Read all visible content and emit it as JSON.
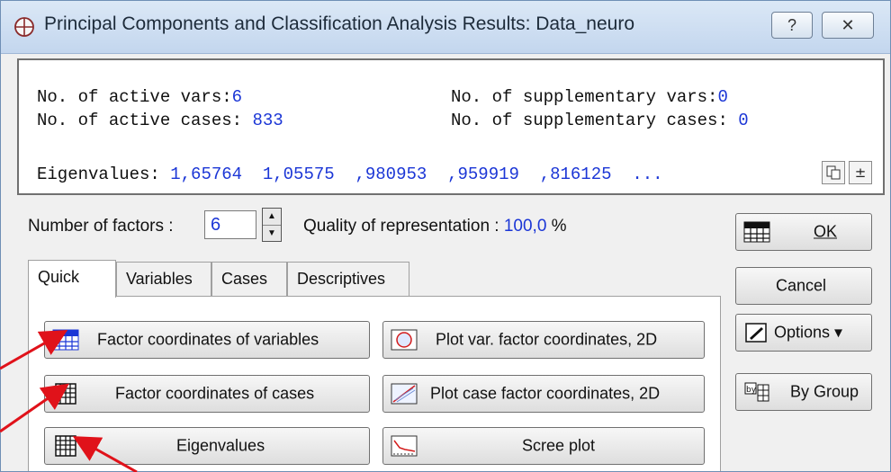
{
  "window": {
    "title": "Principal Components and Classification Analysis Results: Data_neuro",
    "help_label": "?",
    "close_label": "✕"
  },
  "info": {
    "active_vars_label": "No. of active vars:",
    "active_vars_value": "6",
    "supp_vars_label": "No. of supplementary vars:",
    "supp_vars_value": "0",
    "active_cases_label": "No. of active cases: ",
    "active_cases_value": "833",
    "supp_cases_label": "No. of supplementary cases: ",
    "supp_cases_value": "0",
    "eigen_label": "Eigenvalues: ",
    "eigen_values": "1,65764  1,05575  ,980953  ,959919  ,816125  ...",
    "copy_icon": "copy-icon",
    "expand_label": "±"
  },
  "controls": {
    "factors_label": "Number of factors :",
    "factors_value": "6",
    "quality_label": "Quality of representation : ",
    "quality_value": "100,0",
    "quality_unit": " %"
  },
  "tabs": [
    "Quick",
    "Variables",
    "Cases",
    "Descriptives"
  ],
  "buttons": {
    "factor_vars": "Factor coordinates of variables",
    "plot_var": "Plot var. factor coordinates, 2D",
    "factor_cases": "Factor coordinates of cases",
    "plot_case": "Plot case factor coordinates, 2D",
    "eigenvalues": "Eigenvalues",
    "scree": "Scree plot",
    "ok": "OK",
    "cancel": "Cancel",
    "options": "Options ▾",
    "by_group": "By Group"
  },
  "colors": {
    "value_blue": "#1b36d6",
    "annotation_red": "#e0121a"
  }
}
